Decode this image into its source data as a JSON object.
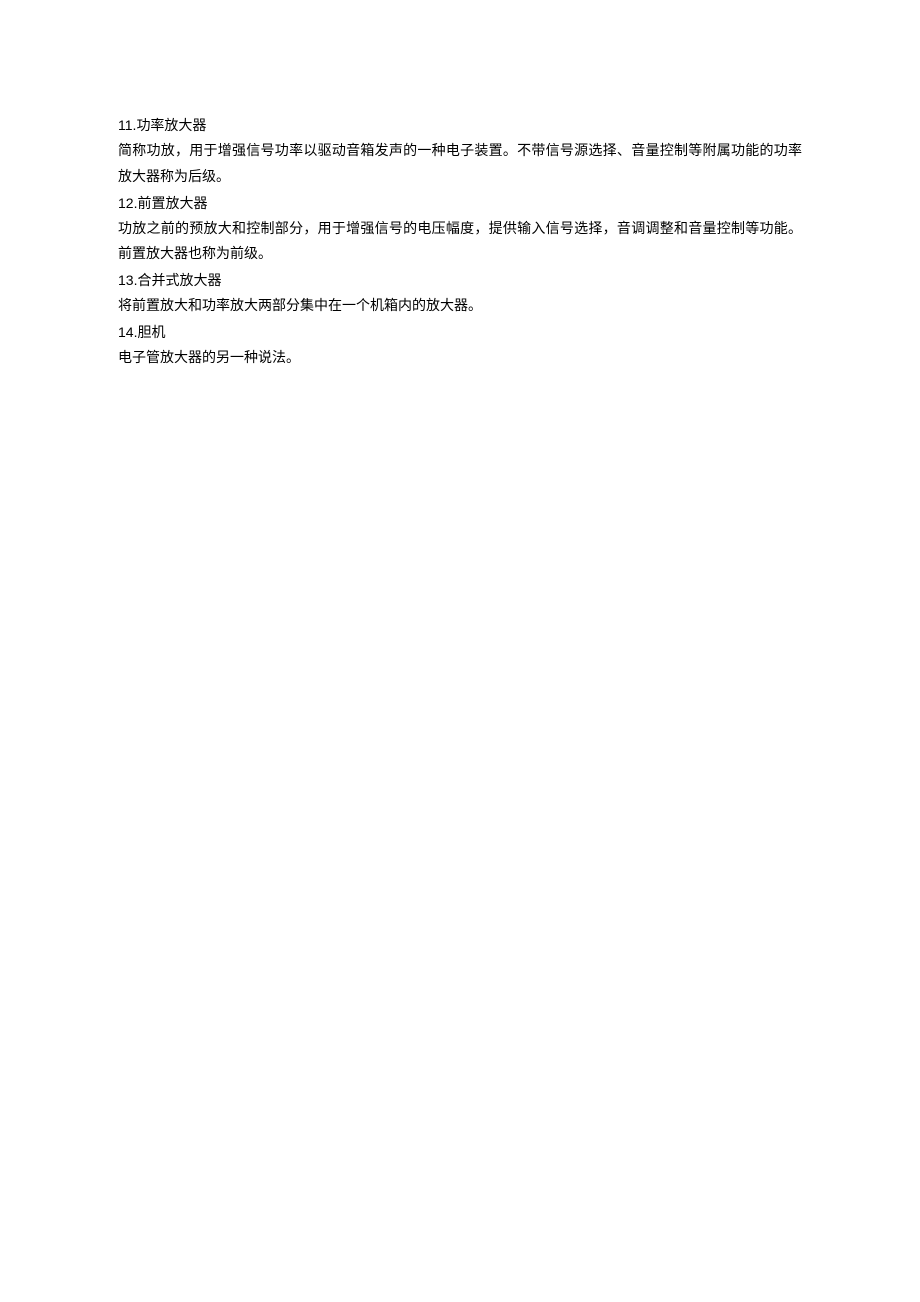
{
  "items": [
    {
      "number": "11.",
      "title": "功率放大器",
      "desc": "简称功放，用于增强信号功率以驱动音箱发声的一种电子装置。不带信号源选择、音量控制等附属功能的功率放大器称为后级。"
    },
    {
      "number": "12.",
      "title": "前置放大器",
      "desc": "功放之前的预放大和控制部分，用于增强信号的电压幅度，提供输入信号选择，音调调整和音量控制等功能。前置放大器也称为前级。"
    },
    {
      "number": "13.",
      "title": "合并式放大器",
      "desc": "将前置放大和功率放大两部分集中在一个机箱内的放大器。"
    },
    {
      "number": "14.",
      "title": "胆机",
      "desc": "电子管放大器的另一种说法。"
    }
  ]
}
